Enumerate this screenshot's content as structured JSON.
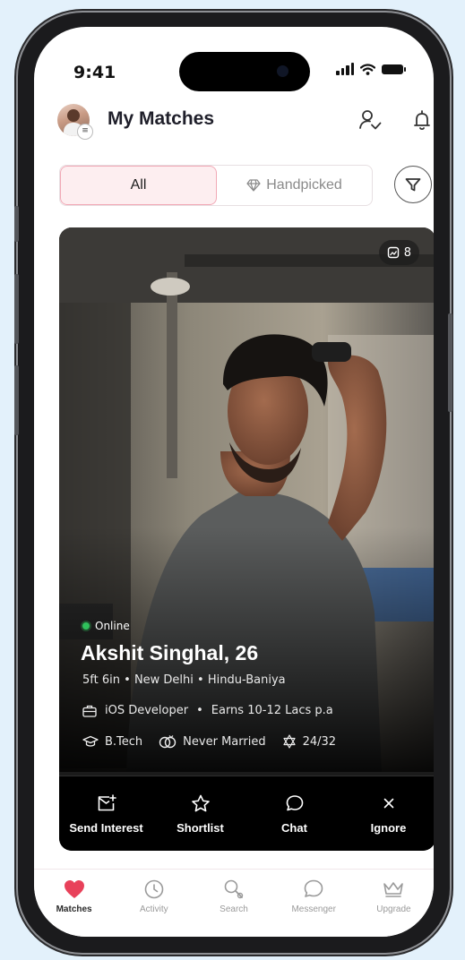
{
  "status_bar": {
    "time": "9:41"
  },
  "header": {
    "title": "My Matches",
    "avatar_badge": "≡"
  },
  "tabs": [
    {
      "label": "All",
      "active": true
    },
    {
      "label": "Handpicked",
      "active": false
    }
  ],
  "profile": {
    "photo_count": "8",
    "status": "Online",
    "name_age": "Akshit Singhal, 26",
    "height": "5ft 6in",
    "city": "New Delhi",
    "community": "Hindu-Baniya",
    "job": "iOS Developer",
    "income": "Earns 10-12 Lacs p.a",
    "education": "B.Tech",
    "marital_status": "Never Married",
    "compatibility": "24/32"
  },
  "actions": [
    {
      "label": "Send Interest",
      "icon": "send-interest-icon"
    },
    {
      "label": "Shortlist",
      "icon": "star-icon"
    },
    {
      "label": "Chat",
      "icon": "chat-icon"
    },
    {
      "label": "Ignore",
      "icon": "close-icon"
    }
  ],
  "bottom_nav": [
    {
      "label": "Matches",
      "icon": "heart-icon",
      "active": true
    },
    {
      "label": "Activity",
      "icon": "clock-icon",
      "active": false
    },
    {
      "label": "Search",
      "icon": "search-icon",
      "active": false
    },
    {
      "label": "Messenger",
      "icon": "messenger-icon",
      "active": false
    },
    {
      "label": "Upgrade",
      "icon": "crown-icon",
      "active": false
    }
  ],
  "colors": {
    "accent": "#e8415a",
    "tab_active_bg": "#fdeef0",
    "tab_active_border": "#f1a9b6",
    "online": "#2fc25b",
    "background": "#e3f1fb"
  }
}
